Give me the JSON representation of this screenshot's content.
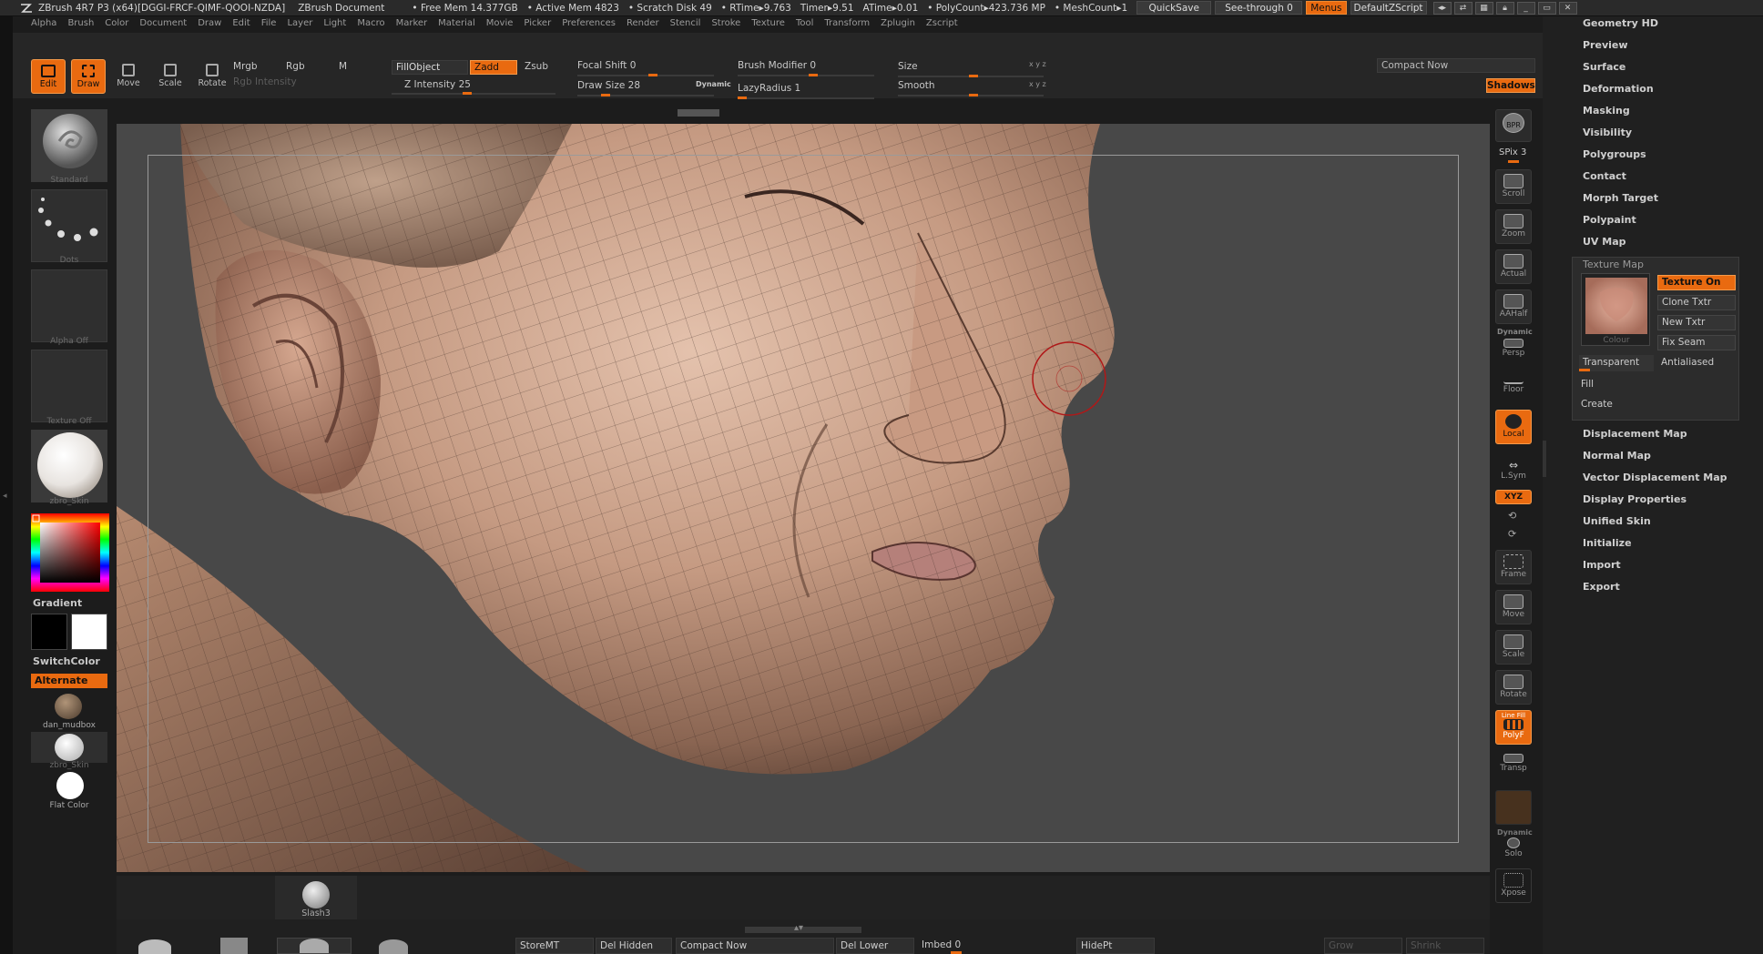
{
  "titlebar": {
    "app": "ZBrush 4R7 P3 (x64)[DGGI-FRCF-QIMF-QOOI-NZDA]",
    "doc": "ZBrush Document",
    "free_mem": "• Free Mem 14.377GB",
    "active_mem": "• Active Mem 4823",
    "scratch": "• Scratch Disk 49",
    "rtime": "• RTime▸9.763",
    "timer": "Timer▸9.51",
    "atime": "ATime▸0.01",
    "polycount": "• PolyCount▸423.736 MP",
    "meshcount": "• MeshCount▸1",
    "quicksave": "QuickSave",
    "seethrough": "See-through  0",
    "menus": "Menus",
    "zscript": "DefaultZScript"
  },
  "menubar": [
    "Alpha",
    "Brush",
    "Color",
    "Document",
    "Draw",
    "Edit",
    "File",
    "Layer",
    "Light",
    "Macro",
    "Marker",
    "Material",
    "Movie",
    "Picker",
    "Preferences",
    "Render",
    "Stencil",
    "Stroke",
    "Texture",
    "Tool",
    "Transform",
    "Zplugin",
    "Zscript"
  ],
  "toolbar": {
    "edit": "Edit",
    "draw": "Draw",
    "move": "Move",
    "scale": "Scale",
    "rotate": "Rotate",
    "mrgb": "Mrgb",
    "rgb": "Rgb",
    "m": "M",
    "rgb_intensity": "Rgb Intensity",
    "fillobject": "FillObject",
    "zadd": "Zadd",
    "zsub": "Zsub",
    "z_intensity": "Z Intensity 25",
    "focal_shift": "Focal Shift 0",
    "draw_size": "Draw Size 28",
    "dynamic": "Dynamic",
    "brush_modifier": "Brush Modifier 0",
    "lazyradius": "LazyRadius 1",
    "size": "Size",
    "smooth": "Smooth",
    "xyz1": "x y z",
    "xyz2": "x y z",
    "compact_now": "Compact Now",
    "shadows": "Shadows"
  },
  "tray": {
    "standard": "Standard",
    "dots": "Dots",
    "alpha_off": "Alpha  Off",
    "texture_off": "Texture  Off",
    "zbro_skin": "zbro_Skin",
    "gradient": "Gradient",
    "switchcolor": "SwitchColor",
    "alternate": "Alternate",
    "dan_mudbox": "dan_mudbox",
    "zbro_skin2": "zbro_Skin",
    "flat_color": "Flat  Color"
  },
  "rightshelf": {
    "bpr": "BPR",
    "spix": "SPix 3",
    "scroll": "Scroll",
    "zoom": "Zoom",
    "actual": "Actual",
    "aahalf": "AAHalf",
    "dynamic": "Dynamic",
    "persp": "Persp",
    "floor": "Floor",
    "local": "Local",
    "lsym": "L.Sym",
    "xyz": "XYZ",
    "frame": "Frame",
    "move": "Move",
    "scale": "Scale",
    "rotate": "Rotate",
    "linefill": "Line Fill",
    "polyf": "PolyF",
    "transp": "Transp",
    "dynamic2": "Dynamic",
    "solo": "Solo",
    "xpose": "Xpose"
  },
  "rightpanel": {
    "items_top": [
      "Geometry HD",
      "Preview",
      "Surface",
      "Deformation",
      "Masking",
      "Visibility",
      "Polygroups",
      "Contact",
      "Morph Target",
      "Polypaint",
      "UV Map"
    ],
    "texture_map": {
      "title": "Texture Map",
      "texture_on": "Texture On",
      "clone_txtr": "Clone Txtr",
      "new_txtr": "New Txtr",
      "fix_seam": "Fix Seam",
      "colour": "Colour",
      "transparent": "Transparent",
      "antialiased": "Antialiased",
      "fill": "Fill",
      "create": "Create"
    },
    "items_bottom": [
      "Displacement Map",
      "Normal Map",
      "Vector Displacement Map",
      "Display Properties",
      "Unified Skin",
      "Initialize",
      "Import",
      "Export"
    ]
  },
  "bottom": {
    "slash3": "Slash3",
    "storemt": "StoreMT",
    "del_hidden": "Del Hidden",
    "compact_now": "Compact Now",
    "del_lower": "Del Lower",
    "imbed": "Imbed 0",
    "hidept": "HidePt",
    "grow": "Grow",
    "shrink": "Shrink"
  }
}
